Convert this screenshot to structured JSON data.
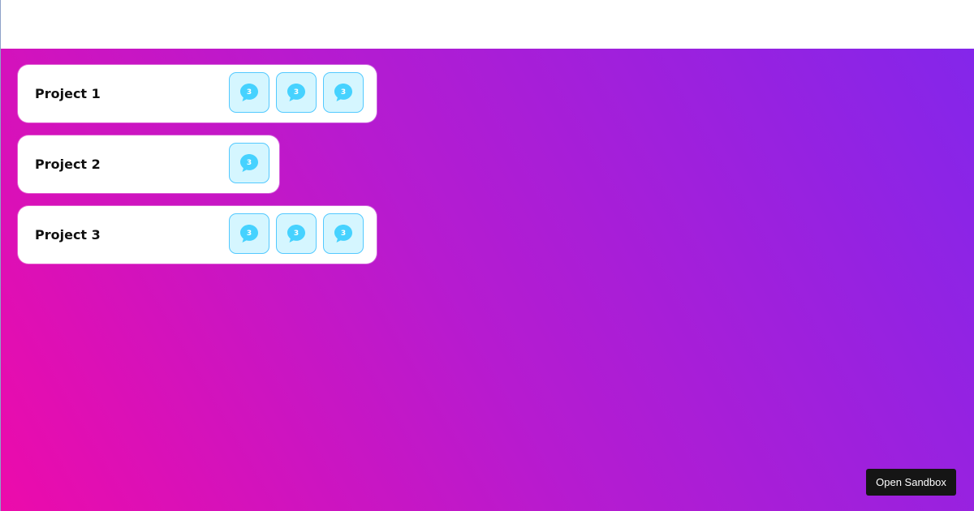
{
  "projects": [
    {
      "title": "Project 1",
      "chips": [
        {
          "count": "3",
          "icon": "chat-bubble-icon"
        },
        {
          "count": "3",
          "icon": "chat-bubble-icon"
        },
        {
          "count": "3",
          "icon": "chat-bubble-icon"
        }
      ]
    },
    {
      "title": "Project 2",
      "chips": [
        {
          "count": "3",
          "icon": "chat-bubble-icon"
        }
      ]
    },
    {
      "title": "Project 3",
      "chips": [
        {
          "count": "3",
          "icon": "chat-bubble-icon"
        },
        {
          "count": "3",
          "icon": "chat-bubble-icon"
        },
        {
          "count": "3",
          "icon": "chat-bubble-icon"
        }
      ]
    }
  ],
  "sandbox_button_label": "Open Sandbox",
  "colors": {
    "gradient_start": "#ec0bab",
    "gradient_mid": "#b61bd0",
    "gradient_end": "#8426ea",
    "chip_background": "#d5f6ff",
    "chip_border": "#53c9ff",
    "chat_icon": "#46d2ff",
    "button_background": "#151515"
  }
}
